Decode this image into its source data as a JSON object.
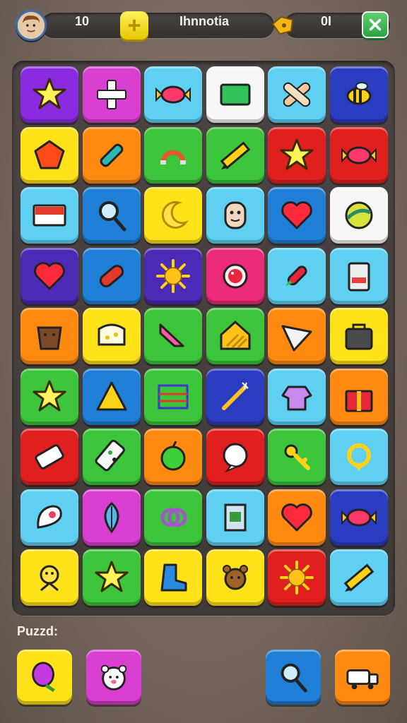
{
  "hud": {
    "left_value": "10",
    "center_label": "Ihnnotia",
    "right_value": "0I",
    "close_icon": "close-x-icon",
    "add_icon": "plus-icon",
    "coin_icon": "gold-nugget-icon",
    "avatar_icon": "player-avatar-icon"
  },
  "colors": {
    "purple": "#8a2be2",
    "magenta": "#d93fd0",
    "lightblue": "#5fd0f2",
    "white": "#f7f7f7",
    "blue": "#1f7fd6",
    "navy": "#2a3cc0",
    "yellow": "#ffe21a",
    "orange": "#ff8a12",
    "green": "#3cc43a",
    "red": "#e0201f",
    "pink": "#ec2a7a",
    "violet": "#4b2ab5"
  },
  "board": {
    "rows": [
      [
        {
          "bg": "purple",
          "icon": "star-icon"
        },
        {
          "bg": "magenta",
          "icon": "plus-icon"
        },
        {
          "bg": "lightblue",
          "icon": "candy-icon"
        },
        {
          "bg": "white",
          "icon": "green-card-icon"
        },
        {
          "bg": "lightblue",
          "icon": "bandage-icon"
        },
        {
          "bg": "navy",
          "icon": "bee-icon"
        }
      ],
      [
        {
          "bg": "yellow",
          "icon": "pentagon-icon"
        },
        {
          "bg": "orange",
          "icon": "pen-icon"
        },
        {
          "bg": "green",
          "icon": "magnet-icon"
        },
        {
          "bg": "green",
          "icon": "pencil-icon"
        },
        {
          "bg": "red",
          "icon": "star-icon"
        },
        {
          "bg": "red",
          "icon": "candy-icon"
        }
      ],
      [
        {
          "bg": "lightblue",
          "icon": "flag-card-icon"
        },
        {
          "bg": "blue",
          "icon": "magnifier-icon"
        },
        {
          "bg": "yellow",
          "icon": "moon-icon"
        },
        {
          "bg": "lightblue",
          "icon": "face-icon"
        },
        {
          "bg": "blue",
          "icon": "heart-icon"
        },
        {
          "bg": "white",
          "icon": "ball-icon"
        }
      ],
      [
        {
          "bg": "violet",
          "icon": "heart-icon"
        },
        {
          "bg": "blue",
          "icon": "capsule-icon"
        },
        {
          "bg": "violet",
          "icon": "sun-icon"
        },
        {
          "bg": "pink",
          "icon": "cookie-icon"
        },
        {
          "bg": "lightblue",
          "icon": "rocket-icon"
        },
        {
          "bg": "lightblue",
          "icon": "jar-icon"
        }
      ],
      [
        {
          "bg": "orange",
          "icon": "pot-icon"
        },
        {
          "bg": "yellow",
          "icon": "cheese-icon"
        },
        {
          "bg": "green",
          "icon": "crayon-icon"
        },
        {
          "bg": "green",
          "icon": "house-icon"
        },
        {
          "bg": "orange",
          "icon": "cone-icon"
        },
        {
          "bg": "yellow",
          "icon": "bag-icon"
        }
      ],
      [
        {
          "bg": "green",
          "icon": "star-icon"
        },
        {
          "bg": "blue",
          "icon": "triangle-icon"
        },
        {
          "bg": "green",
          "icon": "abacus-icon"
        },
        {
          "bg": "navy",
          "icon": "wand-icon"
        },
        {
          "bg": "lightblue",
          "icon": "shirt-icon"
        },
        {
          "bg": "orange",
          "icon": "gift-icon"
        }
      ],
      [
        {
          "bg": "red",
          "icon": "eraser-icon"
        },
        {
          "bg": "green",
          "icon": "domino-icon"
        },
        {
          "bg": "orange",
          "icon": "apple-icon"
        },
        {
          "bg": "red",
          "icon": "chat-icon"
        },
        {
          "bg": "green",
          "icon": "key-icon"
        },
        {
          "bg": "lightblue",
          "icon": "ring-icon"
        }
      ],
      [
        {
          "bg": "lightblue",
          "icon": "ghost-icon"
        },
        {
          "bg": "magenta",
          "icon": "leaf-icon"
        },
        {
          "bg": "green",
          "icon": "pretzel-icon"
        },
        {
          "bg": "lightblue",
          "icon": "frame-icon"
        },
        {
          "bg": "orange",
          "icon": "heart-icon"
        },
        {
          "bg": "navy",
          "icon": "candy-icon"
        }
      ],
      [
        {
          "bg": "yellow",
          "icon": "alien-icon"
        },
        {
          "bg": "green",
          "icon": "star-icon"
        },
        {
          "bg": "yellow",
          "icon": "boot-icon"
        },
        {
          "bg": "yellow",
          "icon": "bear-icon"
        },
        {
          "bg": "red",
          "icon": "sun-icon"
        },
        {
          "bg": "lightblue",
          "icon": "pencil-icon"
        }
      ]
    ]
  },
  "footer": {
    "label": "Puzzd:",
    "buttons": [
      {
        "bg": "yellow",
        "icon": "balloon-icon"
      },
      {
        "bg": "magenta",
        "icon": "polar-bear-icon"
      },
      {
        "bg": "blue",
        "icon": "magnifier-icon"
      },
      {
        "bg": "orange",
        "icon": "truck-icon"
      }
    ]
  }
}
